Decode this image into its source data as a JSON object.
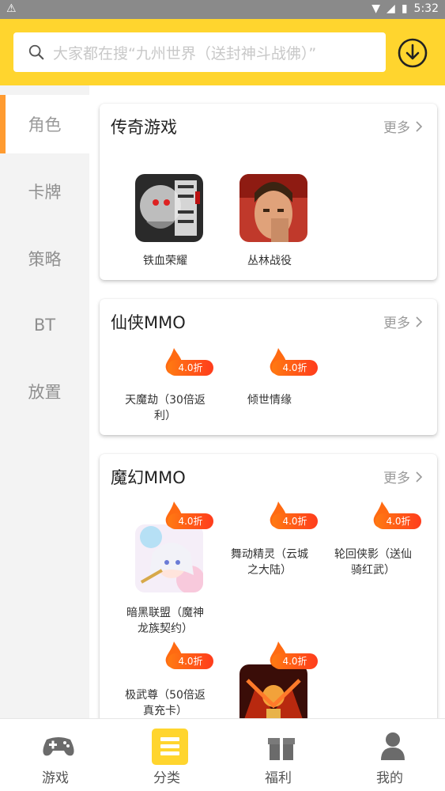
{
  "status_bar": {
    "time": "5:32"
  },
  "search": {
    "placeholder": "大家都在搜“九州世界（送封神斗战佛）”"
  },
  "sidebar": {
    "items": [
      {
        "label": "角色",
        "active": true
      },
      {
        "label": "卡牌",
        "active": false
      },
      {
        "label": "策略",
        "active": false
      },
      {
        "label": "BT",
        "active": false
      },
      {
        "label": "放置",
        "active": false
      }
    ]
  },
  "sections": [
    {
      "title": "传奇游戏",
      "more": "更多",
      "games": [
        {
          "name": "铁血荣耀"
        },
        {
          "name": "丛林战役"
        }
      ]
    },
    {
      "title": "仙侠MMO",
      "more": "更多",
      "games": [
        {
          "name": "天魔劫（30倍返利）",
          "badge": "4.0折"
        },
        {
          "name": "倾世情缘",
          "badge": "4.0折"
        }
      ]
    },
    {
      "title": "魔幻MMO",
      "more": "更多",
      "games": [
        {
          "name": "暗黑联盟（魔神龙族契约）",
          "badge": "4.0折"
        },
        {
          "name": "舞动精灵（云城之大陆）",
          "badge": "4.0折"
        },
        {
          "name": "轮回侠影（送仙骑红武）",
          "badge": "4.0折"
        },
        {
          "name": "极武尊（50倍返真充卡）",
          "badge": "4.0折"
        },
        {
          "name": "",
          "badge": "4.0折"
        }
      ]
    }
  ],
  "bottom_nav": [
    {
      "label": "游戏",
      "icon": "gamepad-icon"
    },
    {
      "label": "分类",
      "icon": "category-icon",
      "active": true
    },
    {
      "label": "福利",
      "icon": "gift-icon"
    },
    {
      "label": "我的",
      "icon": "user-icon"
    }
  ],
  "colors": {
    "accent": "#ffd52e",
    "active_bar": "#ff9b30",
    "badge": "#ff5a1a"
  }
}
